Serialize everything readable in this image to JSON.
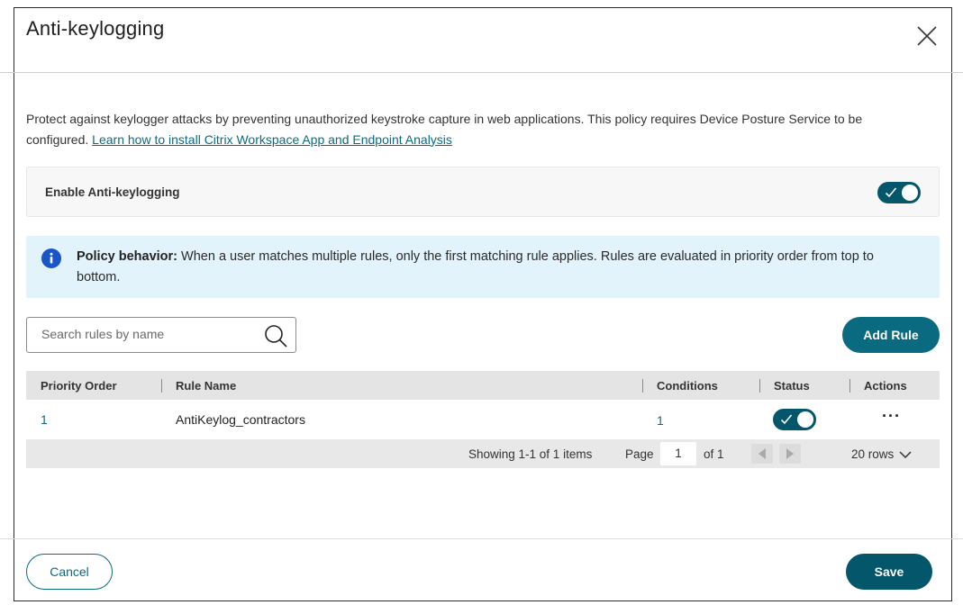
{
  "dialog": {
    "title": "Anti-keylogging",
    "description_text": "Protect against keylogger attacks by preventing unauthorized keystroke capture in web applications. This policy requires Device Posture Service to be configured. ",
    "description_link": "Learn how to install Citrix Workspace App and Endpoint Analysis"
  },
  "enable": {
    "label": "Enable Anti-keylogging",
    "enabled": true
  },
  "info": {
    "title": "Policy behavior:",
    "text": " When a user matches multiple rules, only the first matching rule applies. Rules are evaluated in priority order from top to bottom."
  },
  "search": {
    "placeholder": "Search rules by name",
    "value": ""
  },
  "toolbar": {
    "add_rule_label": "Add Rule"
  },
  "table": {
    "headers": {
      "priority": "Priority Order",
      "name": "Rule Name",
      "conditions": "Conditions",
      "status": "Status",
      "actions": "Actions"
    },
    "rows": [
      {
        "priority": "1",
        "name": "AntiKeylog_contractors",
        "conditions": "1",
        "status_enabled": true,
        "actions": "···"
      }
    ]
  },
  "pager": {
    "showing": "Showing 1-1 of 1 items",
    "page_label": "Page",
    "page_value": "1",
    "of_label": "of 1",
    "rows_label": "20 rows"
  },
  "footer": {
    "cancel_label": "Cancel",
    "save_label": "Save"
  },
  "colors": {
    "accent": "#04566b",
    "link": "#0b6b81",
    "info_bg": "#e3f3fb",
    "info_icon": "#1a55c8"
  }
}
